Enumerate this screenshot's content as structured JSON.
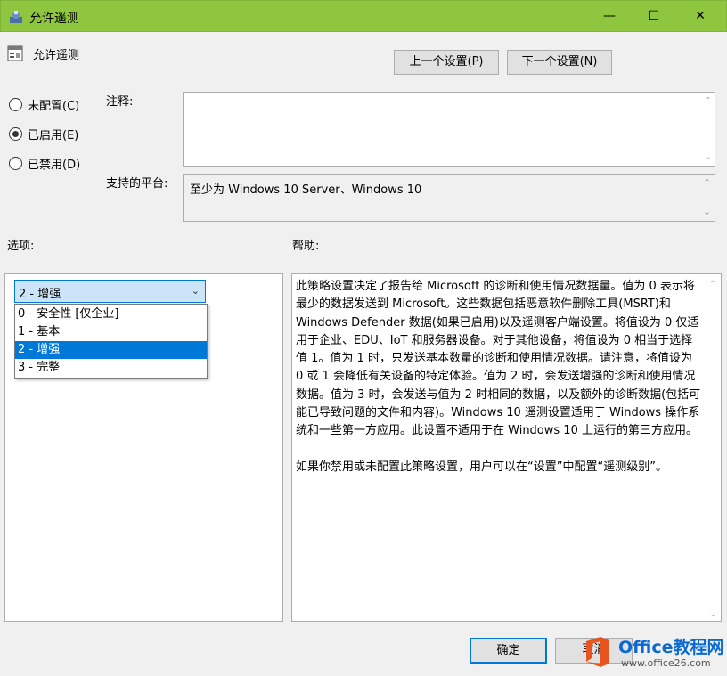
{
  "window": {
    "title": "允许遥测",
    "minimize_glyph": "—",
    "maximize_glyph": "☐",
    "close_glyph": "✕"
  },
  "header": {
    "policy_title": "允许遥测",
    "prev_button": "上一个设置(P)",
    "next_button": "下一个设置(N)"
  },
  "state": {
    "options": [
      {
        "label": "未配置(C)",
        "checked": false
      },
      {
        "label": "已启用(E)",
        "checked": true
      },
      {
        "label": "已禁用(D)",
        "checked": false
      }
    ]
  },
  "comment": {
    "label": "注释:",
    "value": ""
  },
  "platform": {
    "label": "支持的平台:",
    "value": "至少为 Windows 10 Server、Windows 10"
  },
  "options_section": {
    "label": "选项:",
    "selected": "2 - 增强",
    "dropdown_items": [
      {
        "label": "0 - 安全性 [仅企业]",
        "selected": false
      },
      {
        "label": "1 - 基本",
        "selected": false
      },
      {
        "label": "2 - 增强",
        "selected": true
      },
      {
        "label": "3 - 完整",
        "selected": false
      }
    ]
  },
  "help_section": {
    "label": "帮助:",
    "paragraph1": "此策略设置决定了报告给 Microsoft 的诊断和使用情况数据量。值为 0 表示将最少的数据发送到 Microsoft。这些数据包括恶意软件删除工具(MSRT)和 Windows Defender 数据(如果已启用)以及遥测客户端设置。将值设为 0 仅适用于企业、EDU、IoT 和服务器设备。对于其他设备，将值设为 0 相当于选择值 1。值为 1 时，只发送基本数量的诊断和使用情况数据。请注意，将值设为 0 或 1 会降低有关设备的特定体验。值为 2 时，会发送增强的诊断和使用情况数据。值为 3 时，会发送与值为 2 时相同的数据，以及额外的诊断数据(包括可能已导致问题的文件和内容)。Windows 10 遥测设置适用于 Windows 操作系统和一些第一方应用。此设置不适用于在 Windows 10 上运行的第三方应用。",
    "paragraph2": "如果你禁用或未配置此策略设置，用户可以在“设置”中配置“遥测级别”。"
  },
  "footer": {
    "ok_button": "确定",
    "cancel_button": "取消"
  },
  "watermark": {
    "text1": "Office教程网",
    "text2": "www.office26.com"
  },
  "colors": {
    "titlebar": "#8ec63f",
    "accent": "#0078d7"
  }
}
